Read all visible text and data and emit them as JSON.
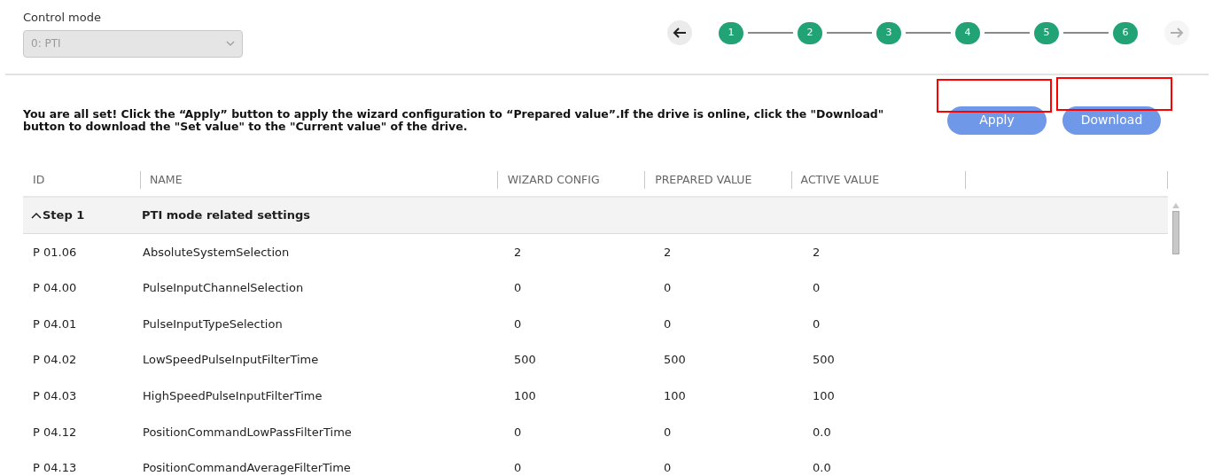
{
  "control_mode": {
    "label": "Control mode",
    "value": "0: PTI",
    "disabled": true
  },
  "stepper": {
    "back": {
      "disabled": false
    },
    "forward": {
      "disabled": true
    },
    "steps": [
      {
        "label": "1"
      },
      {
        "label": "2"
      },
      {
        "label": "3"
      },
      {
        "label": "4"
      },
      {
        "label": "5"
      },
      {
        "label": "6"
      }
    ]
  },
  "message": "You are all set! Click the “Apply” button to apply the wizard configuration to “Prepared value”.If the drive is online, click the \"Download\" button to download the \"Set value\" to the \"Current value\" of the drive.",
  "buttons": [
    {
      "label": "Apply",
      "disabled": true
    },
    {
      "label": "Download",
      "disabled": true
    }
  ],
  "table": {
    "columns": [
      "ID",
      "NAME",
      "WIZARD CONFIG",
      "PREPARED VALUE",
      "ACTIVE VALUE"
    ],
    "groups": [
      {
        "id": "Step 1",
        "name": "PTI mode related settings",
        "expanded": true,
        "rows": [
          [
            "P 01.06",
            "AbsoluteSystemSelection",
            "2",
            "2",
            "2"
          ],
          [
            "P 04.00",
            "PulseInputChannelSelection",
            "0",
            "0",
            "0"
          ],
          [
            "P 04.01",
            "PulseInputTypeSelection",
            "0",
            "0",
            "0"
          ],
          [
            "P 04.02",
            "LowSpeedPulseInputFilterTime",
            "500",
            "500",
            "500"
          ],
          [
            "P 04.03",
            "HighSpeedPulseInputFilterTime",
            "100",
            "100",
            "100"
          ],
          [
            "P 04.12",
            "PositionCommandLowPassFilterTime",
            "0",
            "0",
            "0.0"
          ],
          [
            "P 04.13",
            "PositionCommandAverageFilterTime",
            "0",
            "0",
            "0.0"
          ]
        ]
      }
    ]
  }
}
